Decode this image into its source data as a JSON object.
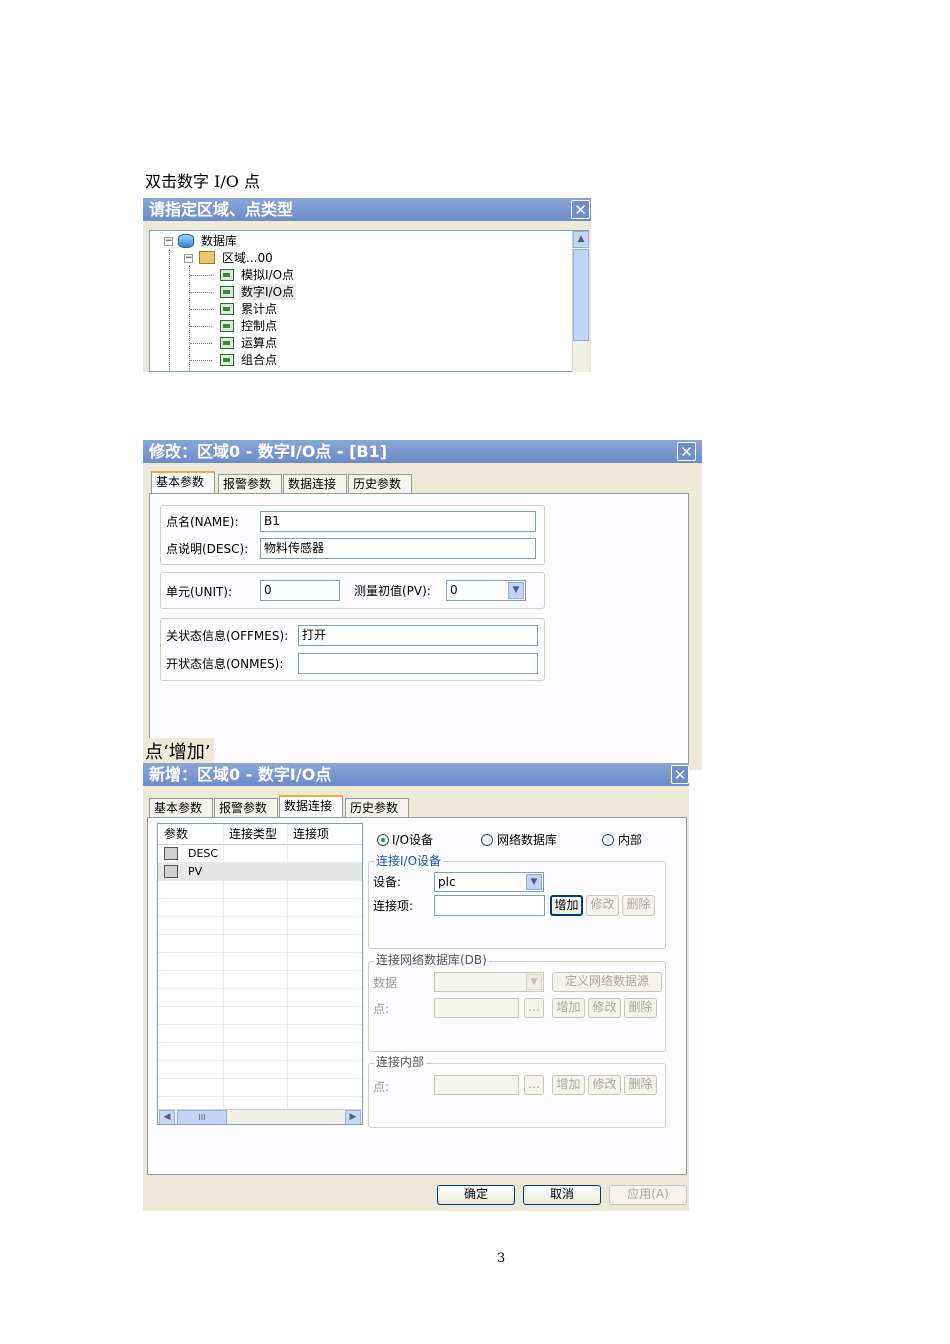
{
  "doc": {
    "caption1": "双击数字 I/O 点",
    "caption2": "点‘增加’",
    "page_number": "3"
  },
  "dialog1": {
    "title": "请指定区域、点类型",
    "close": "✕",
    "tree": {
      "root": "数据库",
      "area": "区域...00",
      "items": [
        "模拟I/O点",
        "数字I/O点",
        "累计点",
        "控制点",
        "运算点",
        "组合点"
      ]
    }
  },
  "dialog2": {
    "title": "修改：区域0 - 数字I/O点 - [B1]",
    "close": "✕",
    "tabs": [
      "基本参数",
      "报警参数",
      "数据连接",
      "历史参数"
    ],
    "active_tab": "基本参数",
    "name_label": "点名(NAME):",
    "name_value": "B1",
    "desc_label": "点说明(DESC):",
    "desc_value": "物料传感器",
    "unit_label": "单元(UNIT):",
    "unit_value": "0",
    "pv_label": "测量初值(PV):",
    "pv_value": "0",
    "offmes_label": "关状态信息(OFFMES):",
    "offmes_value": "打开",
    "onmes_label": "开状态信息(ONMES):",
    "onmes_value": ""
  },
  "dialog3": {
    "title": "新增：区域0 - 数字I/O点",
    "close": "✕",
    "tabs": [
      "基本参数",
      "报警参数",
      "数据连接",
      "历史参数"
    ],
    "active_tab": "数据连接",
    "list_headers": [
      "参数",
      "连接类型",
      "连接项"
    ],
    "list_rows": [
      {
        "param": "DESC",
        "type": "",
        "item": ""
      },
      {
        "param": "PV",
        "type": "",
        "item": ""
      }
    ],
    "scroll_mid": "III",
    "radio_io": "I/O设备",
    "radio_net": "网络数据库",
    "radio_internal": "内部",
    "io_group_title": "连接I/O设备",
    "device_label": "设备:",
    "device_value": "plc",
    "link_label": "连接项:",
    "link_value": "",
    "btn_add": "增加",
    "btn_modify": "修改",
    "btn_delete": "删除",
    "db_group_title": "连接网络数据库(DB)",
    "db_data_label": "数据",
    "db_define_btn": "定义网络数据源",
    "db_point_label": "点:",
    "browse_btn": "...",
    "internal_group_title": "连接内部",
    "internal_point_label": "点:",
    "ok": "确定",
    "cancel": "取消",
    "apply": "应用(A)"
  }
}
